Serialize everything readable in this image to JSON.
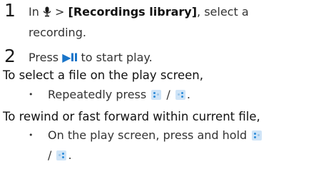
{
  "steps": [
    {
      "number": "1",
      "text_prefix": "In",
      "separator": ">",
      "menu_item": "[Recordings library]",
      "text_suffix": ", select a",
      "text_line2": "recording."
    },
    {
      "number": "2",
      "text_prefix": "Press",
      "play_symbol": "▶II",
      "text_suffix": "to start play."
    }
  ],
  "section_select": {
    "heading": "To select a file on the play screen,",
    "bullet_text": "Repeatedly press",
    "separator": "/",
    "end": "."
  },
  "section_seek": {
    "heading": "To rewind or fast forward within current file,",
    "bullet_text": "On the play screen, press and hold",
    "separator": "/",
    "end": "."
  },
  "icons": {
    "mic": "microphone-icon",
    "prev": "previous-button-icon",
    "next": "next-button-icon",
    "play_pause": "play-pause-icon"
  },
  "colors": {
    "accent": "#1a75c9",
    "button_bg": "#cfe4f7"
  }
}
